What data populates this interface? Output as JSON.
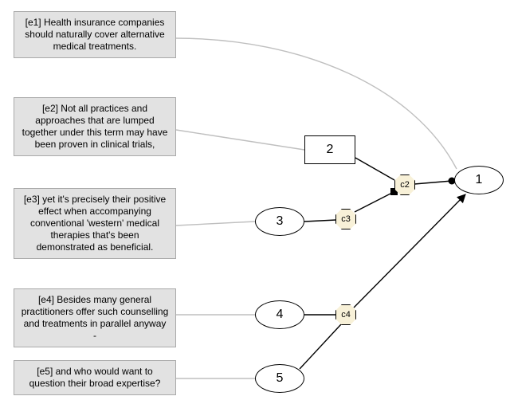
{
  "statements": {
    "e1": "[e1] Health insurance companies should naturally cover alternative medical treatments.",
    "e2": "[e2] Not all practices and approaches that are lumped together under this term may have been proven in clinical trials,",
    "e3": "[e3] yet it's precisely their positive effect when accompanying conventional 'western' medical therapies that's been demonstrated as beneficial.",
    "e4": "[e4] Besides many general practitioners offer such counselling and treatments in parallel anyway -",
    "e5": "[e5] and who would want to question their broad expertise?"
  },
  "nodes": {
    "n1": "1",
    "n2": "2",
    "n3": "3",
    "n4": "4",
    "n5": "5"
  },
  "connectors": {
    "c2": "c2",
    "c3": "c3",
    "c4": "c4"
  }
}
